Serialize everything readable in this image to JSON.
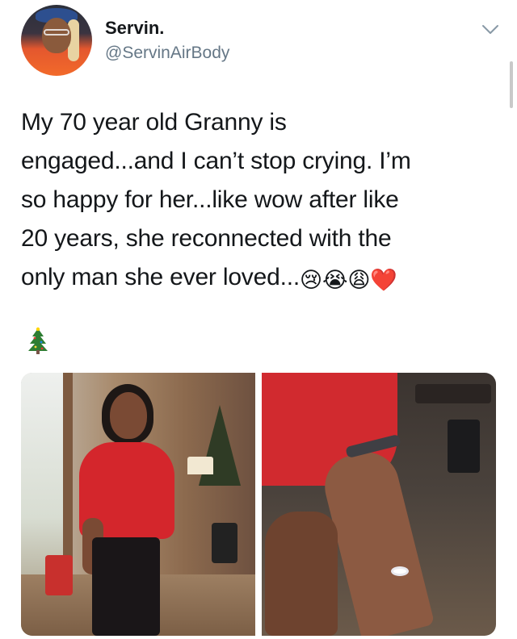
{
  "tweet": {
    "author": {
      "name": "Servin.",
      "handle": "@ServinAirBody",
      "avatar_icon": "profile-photo"
    },
    "menu_icon": "chevron-down-icon",
    "text_lines": [
      "My 70 year old Granny is",
      "engaged...and I can’t stop crying. I’m",
      "so happy for her...like wow after like",
      "20 years, she reconnected with the",
      "only man she ever loved..."
    ],
    "emojis": [
      "😢",
      "😭",
      "😩",
      "❤️"
    ],
    "trailing_emoji": "christmas-tree-icon",
    "media": [
      {
        "name": "photo-woman-in-red-sweater"
      },
      {
        "name": "photo-hand-with-ring"
      }
    ]
  },
  "colors": {
    "name": "#14171a",
    "handle": "#657786",
    "text": "#14171a",
    "heart": "#e0245e"
  }
}
